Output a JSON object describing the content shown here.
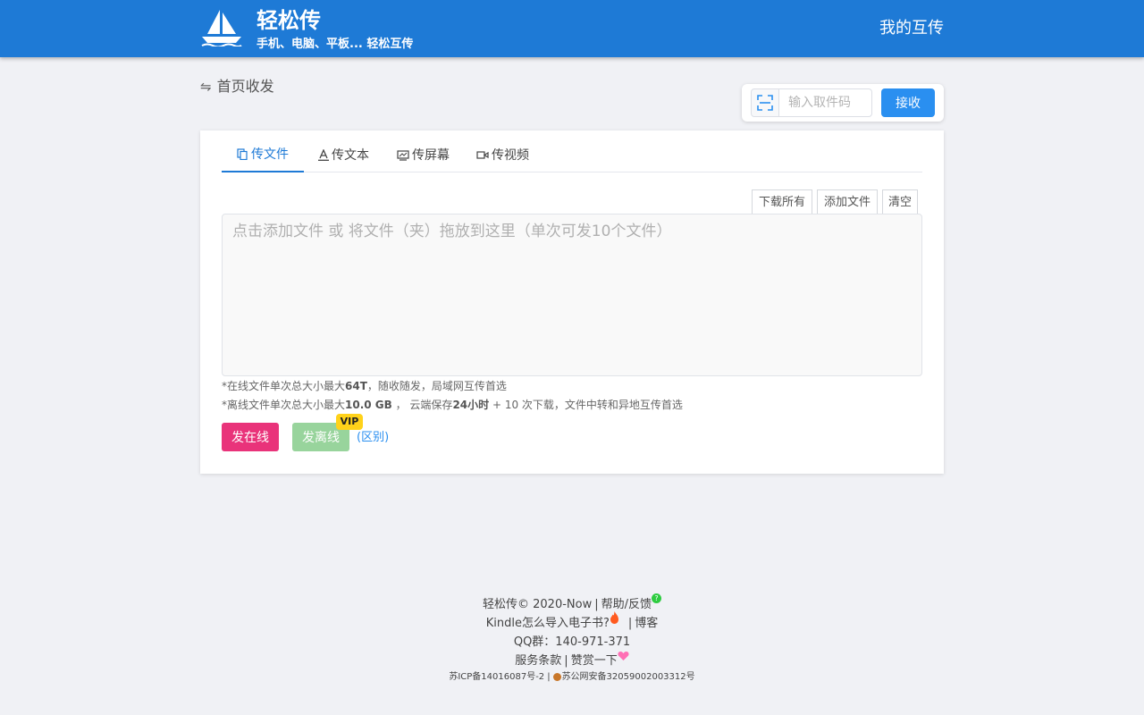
{
  "header": {
    "title": "轻松传",
    "subtitle": "手机、电脑、平板... 轻松互传",
    "my_transfer": "我的互传"
  },
  "breadcrumb": {
    "label": "首页收发"
  },
  "receive": {
    "placeholder": "输入取件码",
    "button": "接收"
  },
  "tabs": [
    {
      "label": "传文件",
      "active": true
    },
    {
      "label": "传文本",
      "active": false
    },
    {
      "label": "传屏幕",
      "active": false
    },
    {
      "label": "传视频",
      "active": false
    }
  ],
  "file_actions": {
    "download_all": "下载所有",
    "add_file": "添加文件",
    "clear": "清空"
  },
  "dropzone": {
    "hint": "点击添加文件 或 将文件（夹）拖放到这里（单次可发10个文件）"
  },
  "notes": {
    "online_prefix": "*在线文件单次总大小最大",
    "online_limit": "64T",
    "online_suffix": "，随收随发，局域网互传首选",
    "offline_prefix": "*离线文件单次总大小最大",
    "offline_limit": "10.0 GB",
    "offline_mid": " ， 云端保存",
    "offline_keep": "24小时",
    "offline_suffix": " + 10 次下载，文件中转和异地互传首选"
  },
  "send": {
    "online": "发在线",
    "offline": "发离线",
    "vip": "VIP",
    "diff": "(区别)"
  },
  "footer": {
    "copyright": "轻松传© 2020-Now",
    "help": "帮助/反馈",
    "kindle": "Kindle怎么导入电子书?",
    "blog": "博客",
    "qq": "QQ群：140-971-371",
    "terms": "服务条款",
    "donate": "赞赏一下",
    "icp": "苏ICP备14016087号-2",
    "police": "苏公网安备32059002003312号"
  },
  "colors": {
    "header_bg": "#1e7ad6",
    "accent": "#2a8ff0",
    "send_online": "#e9337a",
    "send_offline": "#98d49c",
    "vip": "#ffd21a"
  }
}
